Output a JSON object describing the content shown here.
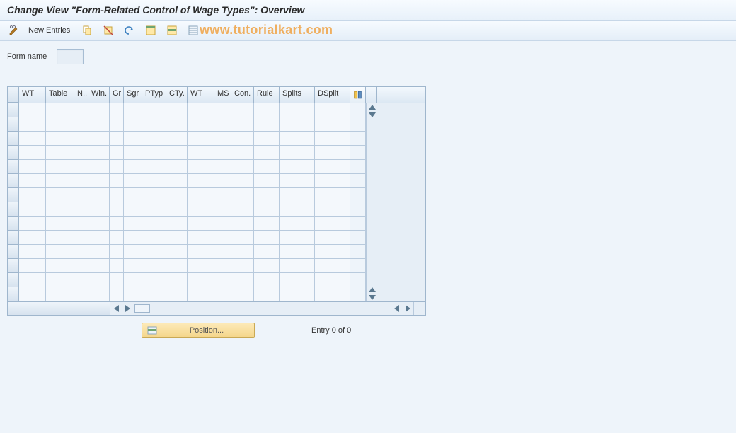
{
  "title": "Change View \"Form-Related Control of Wage Types\": Overview",
  "toolbar": {
    "new_entries_label": "New Entries"
  },
  "watermark": "www.tutorialkart.com",
  "form": {
    "label": "Form name",
    "value": ""
  },
  "grid": {
    "columns": [
      {
        "label": "",
        "width": 16
      },
      {
        "label": "WT",
        "width": 38
      },
      {
        "label": "Table",
        "width": 40
      },
      {
        "label": "N..",
        "width": 20
      },
      {
        "label": "Win.",
        "width": 30
      },
      {
        "label": "Gr",
        "width": 20
      },
      {
        "label": "Sgr",
        "width": 26
      },
      {
        "label": "PTyp",
        "width": 34
      },
      {
        "label": "CTy.",
        "width": 30
      },
      {
        "label": "WT",
        "width": 38
      },
      {
        "label": "MS",
        "width": 24
      },
      {
        "label": "Con.",
        "width": 32
      },
      {
        "label": "Rule",
        "width": 36
      },
      {
        "label": "Splits",
        "width": 50
      },
      {
        "label": "DSplit",
        "width": 50
      }
    ],
    "config_column_width": 22,
    "scroll_column_width": 16,
    "row_count": 14,
    "rows": []
  },
  "position_button_label": "Position...",
  "entry_status": "Entry 0 of 0"
}
